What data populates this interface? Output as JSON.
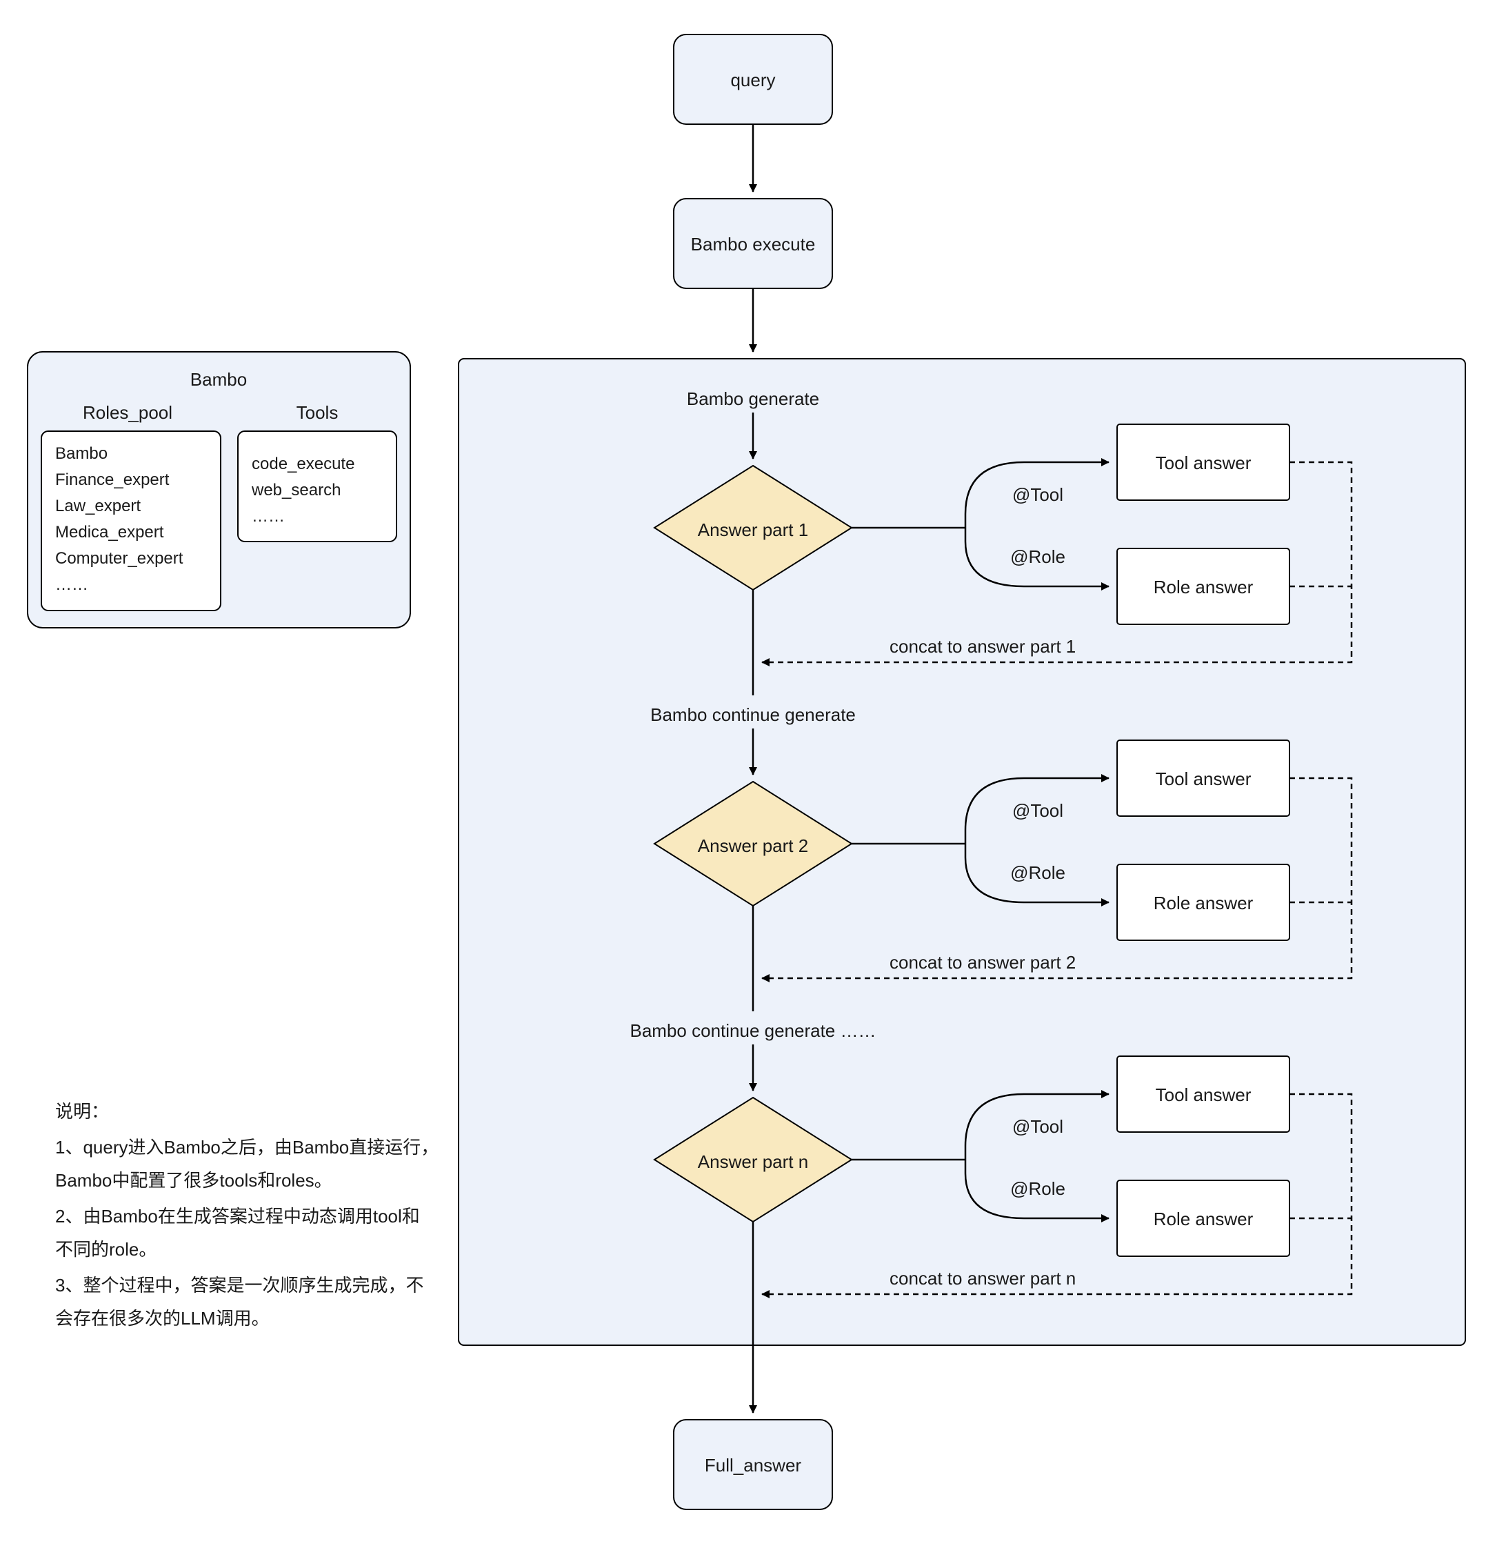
{
  "nodes": {
    "query": "query",
    "bambo_execute": "Bambo execute",
    "bambo_generate": "Bambo generate",
    "bambo_continue_generate": "Bambo continue generate",
    "bambo_continue_generate_n": "Bambo continue generate ……",
    "answer_part_1": "Answer part 1",
    "answer_part_2": "Answer part 2",
    "answer_part_n": "Answer part n",
    "tool_answer": "Tool answer",
    "role_answer": "Role answer",
    "full_answer": "Full_answer",
    "at_tool": "@Tool",
    "at_role": "@Role",
    "concat_1": "concat to answer part 1",
    "concat_2": "concat to answer part 2",
    "concat_n": "concat to answer part n"
  },
  "bambo_panel": {
    "title": "Bambo",
    "roles_pool_title": "Roles_pool",
    "tools_title": "Tools",
    "roles": [
      "Bambo",
      "Finance_expert",
      "Law_expert",
      "Medica_expert",
      "Computer_expert",
      "……"
    ],
    "tools": [
      "code_execute",
      "web_search",
      "……"
    ]
  },
  "explanation": {
    "title": "说明：",
    "line1": "1、query进入Bambo之后，由Bambo直接运行，",
    "line1b": "Bambo中配置了很多tools和roles。",
    "line2": "2、由Bambo在生成答案过程中动态调用tool和",
    "line2b": "不同的role。",
    "line3": "3、整个过程中，答案是一次顺序生成完成，不",
    "line3b": "会存在很多次的LLM调用。"
  },
  "colors": {
    "box_fill": "#edf2fa",
    "diamond_fill": "#f9e9bf",
    "stroke": "#000000"
  }
}
